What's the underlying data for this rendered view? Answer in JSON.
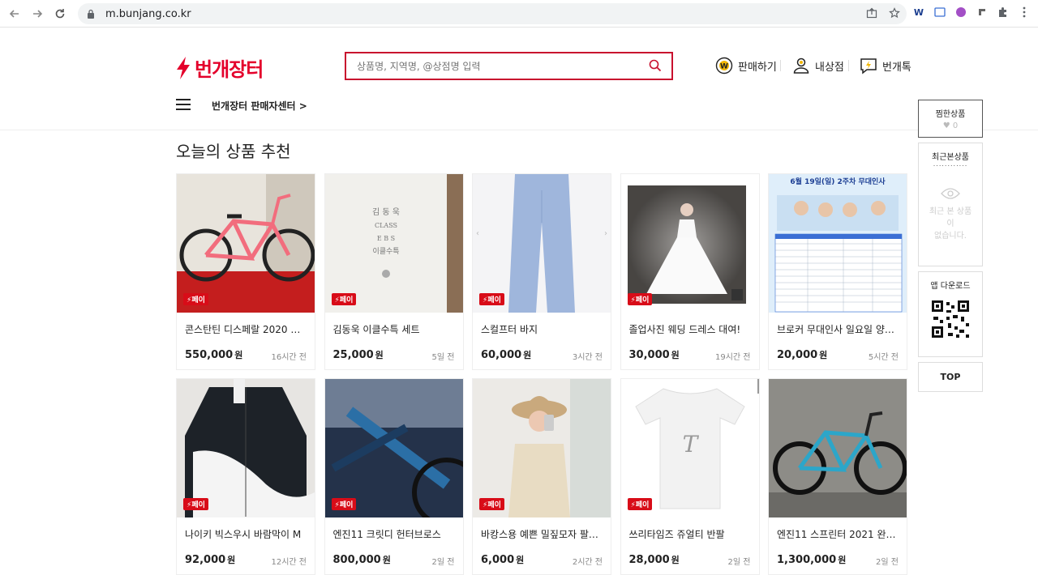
{
  "browser": {
    "url": "m.bunjang.co.kr"
  },
  "header": {
    "logo_text": "번개장터",
    "search_placeholder": "상품명, 지역명, @상점명 입력",
    "menu": {
      "sell": "판매하기",
      "my_shop": "내상점",
      "talk": "번개톡"
    },
    "seller_center": "번개장터 판매자센터 >"
  },
  "section_title": "오늘의 상품 추천",
  "pay_badge": "페이",
  "currency": "원",
  "products": [
    {
      "name": "콘스탄틴 디스페랄 2020 핑...",
      "price": "550,000",
      "time": "16시간 전"
    },
    {
      "name": "김동욱 이클수특 세트",
      "price": "25,000",
      "time": "5일 전"
    },
    {
      "name": "스컬프터 바지",
      "price": "60,000",
      "time": "3시간 전"
    },
    {
      "name": "졸업사진 웨딩 드레스 대여!",
      "price": "30,000",
      "time": "19시간 전"
    },
    {
      "name": "브로커 무대인사 일요일 양도...",
      "price": "20,000",
      "time": "5시간 전"
    },
    {
      "name": "나이키 빅스우시 바람막이 M",
      "price": "92,000",
      "time": "12시간 전"
    },
    {
      "name": "엔진11 크릿디 헌터브로스",
      "price": "800,000",
      "time": "2일 전"
    },
    {
      "name": "바캉스용 예쁜 밀짚모자 팔아요",
      "price": "6,000",
      "time": "2시간 전"
    },
    {
      "name": "쓰리타임즈 쥬얼티 반팔",
      "price": "28,000",
      "time": "2일 전"
    },
    {
      "name": "엔진11 스프린터 2021 완차 ...",
      "price": "1,300,000",
      "time": "2일 전"
    }
  ],
  "thumb_text": {
    "book": [
      "김 동 욱",
      "CLASS",
      "E B S",
      "이클수특"
    ],
    "poster": "6월 19일(일) 2주차 무대인사"
  },
  "sidebar": {
    "favorites_title": "찜한상품",
    "favorites_count": "♥ 0",
    "recent_title": "최근본상품",
    "recent_dots": "............",
    "recent_empty": [
      "최근 본 상품",
      "이",
      "없습니다."
    ],
    "app_download": "앱 다운로드",
    "top": "TOP"
  },
  "colors": {
    "brand": "#e4002b",
    "pay_badge": "#d80c18"
  }
}
